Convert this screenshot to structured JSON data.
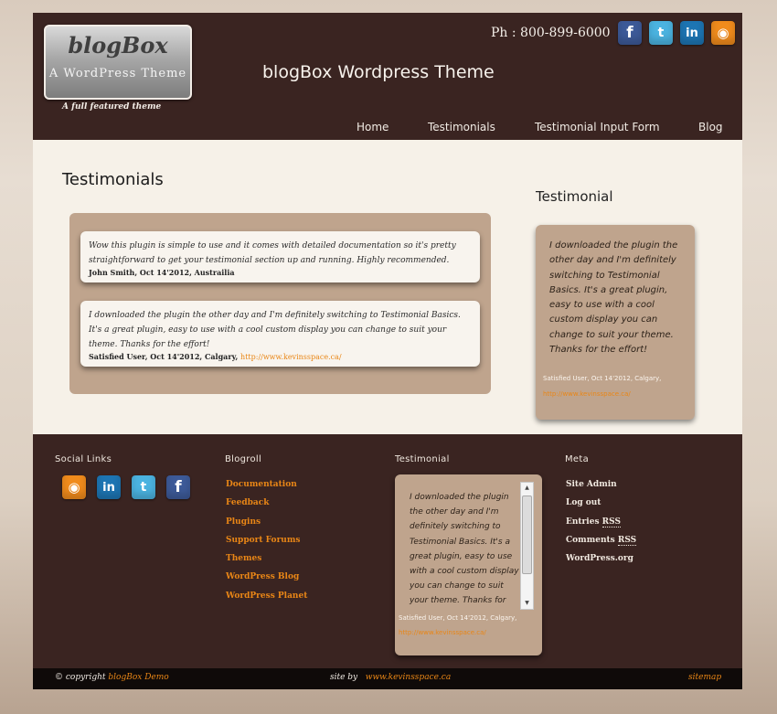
{
  "header": {
    "logo_title": "blogBox",
    "logo_subtitle": "A WordPress Theme",
    "tagline": "A full featured theme",
    "site_title": "blogBox Wordpress Theme",
    "phone": "Ph : 800-899-6000",
    "social_icons": [
      "facebook-icon",
      "twitter-icon",
      "linkedin-icon",
      "rss-icon"
    ]
  },
  "nav": {
    "items": [
      {
        "label": "Home"
      },
      {
        "label": "Testimonials"
      },
      {
        "label": "Testimonial Input Form"
      },
      {
        "label": "Blog"
      }
    ]
  },
  "main": {
    "heading": "Testimonials",
    "testimonials": [
      {
        "quote": "Wow this plugin is simple to use and it comes with detailed documentation so it's pretty straightforward to get your testimonial section up and running. Highly recommended.",
        "author": "John Smith, Oct 14'2012, Austrailia",
        "url": ""
      },
      {
        "quote": "I downloaded the plugin the other day and I'm definitely switching to Testimonial Basics. It's a great plugin, easy to use with a cool custom display you can change to suit your theme. Thanks for the effort!",
        "author": "Satisfied User, Oct 14'2012, Calgary,",
        "url": "http://www.kevinsspace.ca/"
      }
    ]
  },
  "sidebar": {
    "title": "Testimonial",
    "quote": "I downloaded the plugin the other day and I'm definitely switching to Testimonial Basics. It's a great plugin, easy to use with a cool custom display you can change to suit your theme. Thanks for the effort!",
    "author": "Satisfied User, Oct 14'2012, Calgary,",
    "url": "http://www.kevinsspace.ca/"
  },
  "footer": {
    "social_title": "Social Links",
    "social_icons": [
      "rss-icon",
      "linkedin-icon",
      "twitter-icon",
      "facebook-icon"
    ],
    "blogroll_title": "Blogroll",
    "blogroll": [
      "Documentation",
      "Feedback",
      "Plugins",
      "Support Forums",
      "Themes",
      "WordPress Blog",
      "WordPress Planet"
    ],
    "testimonial_title": "Testimonial",
    "testimonial_quote": "I downloaded the plugin the other day and I'm definitely switching to Testimonial Basics. It's a great plugin, easy to use with a cool custom display you can change to suit your theme. Thanks for the effort!",
    "testimonial_author": "Satisfied User, Oct 14'2012, Calgary,",
    "testimonial_url": "http://www.kevinsspace.ca/",
    "meta_title": "Meta",
    "meta": [
      {
        "pre": "Site Admin",
        "abbr": ""
      },
      {
        "pre": "Log out",
        "abbr": ""
      },
      {
        "pre": "Entries ",
        "abbr": "RSS"
      },
      {
        "pre": "Comments ",
        "abbr": "RSS"
      },
      {
        "pre": "WordPress.org",
        "abbr": ""
      }
    ]
  },
  "bottom": {
    "copyright_prefix": "© copyright",
    "copyright_name": "blogBox Demo",
    "site_by": "site by",
    "site_by_link": "www.kevinsspace.ca",
    "sitemap": "sitemap"
  },
  "colors": {
    "header_bg": "#3a2421",
    "content_bg": "#f6f1e8",
    "accent_orange": "#e98616",
    "box_tan": "#bfa48d"
  }
}
